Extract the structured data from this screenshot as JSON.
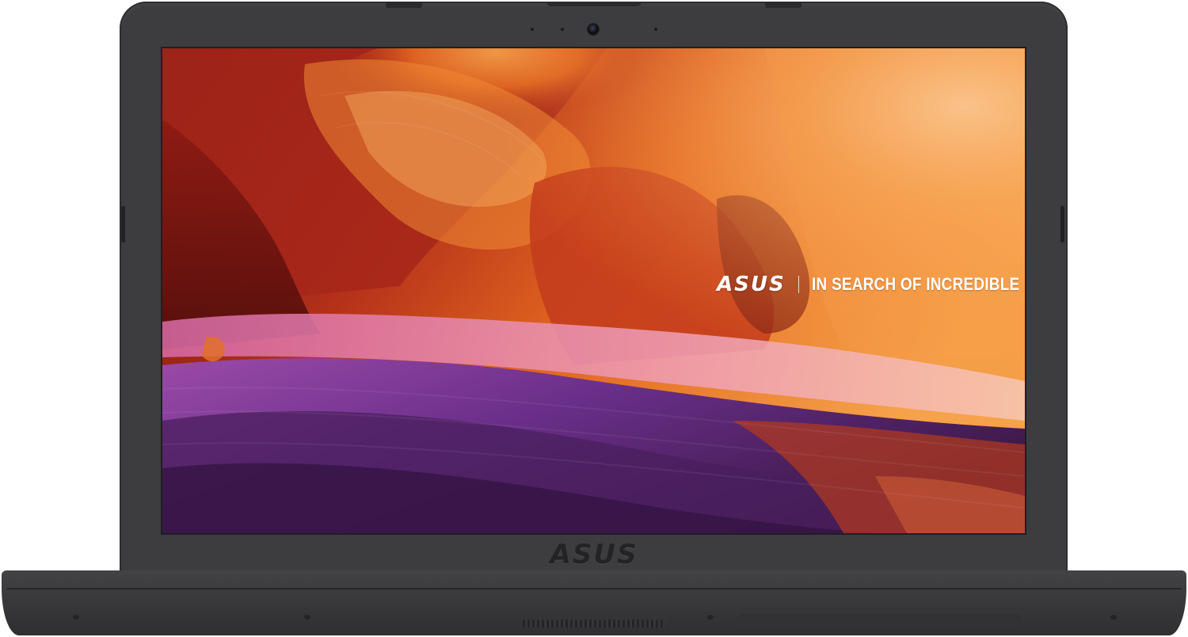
{
  "device": {
    "screen_brand_logo": "ASUS",
    "screen_tagline": "IN SEARCH OF INCREDIBLE",
    "bezel_logo": "ASUS"
  },
  "colors": {
    "bezel": "#3d3d3f",
    "wallpaper_orange": "#f08a2c",
    "wallpaper_red": "#9b1f14",
    "wallpaper_purple": "#7b3d96"
  }
}
